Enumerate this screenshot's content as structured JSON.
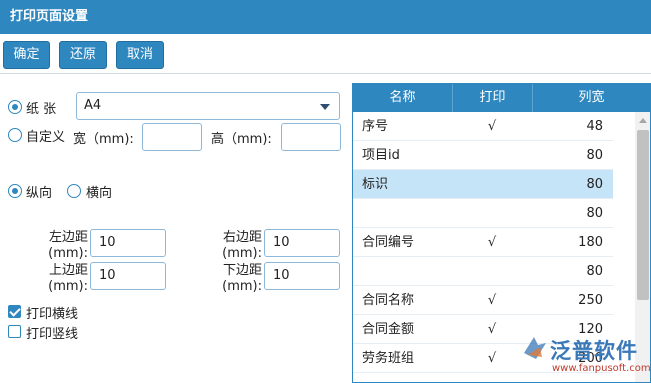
{
  "window": {
    "title": "打印页面设置"
  },
  "toolbar": {
    "ok": "确定",
    "restore": "还原",
    "cancel": "取消"
  },
  "paper": {
    "paper_label": "纸 张",
    "paper_value": "A4",
    "custom_label": "自定义",
    "width_label": "宽（mm):",
    "width_value": "",
    "height_label": "高（mm):",
    "height_value": ""
  },
  "orientation": {
    "portrait_label": "纵向",
    "landscape_label": "横向",
    "selected": "纵向"
  },
  "margins": {
    "left_label": "左边距\n(mm):",
    "left_value": "10",
    "right_label": "右边距\n(mm):",
    "right_value": "10",
    "top_label": "上边距\n(mm):",
    "top_value": "10",
    "bottom_label": "下边距\n(mm):",
    "bottom_value": "10"
  },
  "options": {
    "print_hlines": "打印横线",
    "print_hlines_checked": true,
    "print_vlines": "打印竖线",
    "print_vlines_checked": false
  },
  "grid": {
    "headers": [
      "名称",
      "打印",
      "列宽"
    ],
    "rows": [
      {
        "name": "序号",
        "print": "√",
        "width": "48"
      },
      {
        "name": "项目id",
        "print": "",
        "width": "80"
      },
      {
        "name": "标识",
        "print": "",
        "width": "80",
        "selected": true
      },
      {
        "name": "",
        "print": "",
        "width": "80"
      },
      {
        "name": "合同编号",
        "print": "√",
        "width": "180"
      },
      {
        "name": "",
        "print": "",
        "width": "80"
      },
      {
        "name": "合同名称",
        "print": "√",
        "width": "250"
      },
      {
        "name": "合同金额",
        "print": "√",
        "width": "120"
      },
      {
        "name": "劳务班组",
        "print": "√",
        "width": "200"
      }
    ]
  },
  "watermark": {
    "brand": "泛普软件",
    "url": "www.fanpusoft.com"
  },
  "colors": {
    "accent": "#2f87c0",
    "selected_row": "#c6e4f7"
  }
}
